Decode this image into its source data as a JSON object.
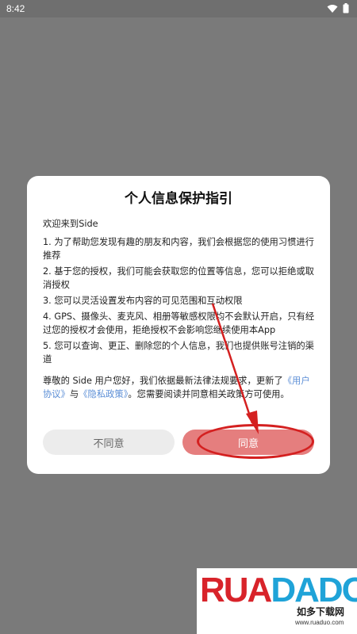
{
  "status_bar": {
    "time": "8:42",
    "icons": [
      "wifi-icon",
      "battery-icon"
    ]
  },
  "dialog": {
    "title": "个人信息保护指引",
    "welcome": "欢迎来到Side",
    "items": [
      "1. 为了帮助您发现有趣的朋友和内容，我们会根据您的使用习惯进行推荐",
      "2. 基于您的授权，我们可能会获取您的位置等信息，您可以拒绝或取消授权",
      "3. 您可以灵活设置发布内容的可见范围和互动权限",
      "4. GPS、摄像头、麦克风、相册等敏感权限均不会默认开启，只有经过您的授权才会使用，拒绝授权不会影响您继续使用本App",
      "5. 您可以查询、更正、删除您的个人信息，我们也提供账号注销的渠道"
    ],
    "notice_prefix": "尊敬的 Side 用户您好，我们依据最新法律法规要求，更新了",
    "user_agreement_link": "《用户协议》",
    "notice_and": "与",
    "privacy_policy_link": "《隐私政策》",
    "notice_suffix": "。您需要阅读并同意相关政策方可使用。",
    "disagree_label": "不同意",
    "agree_label": "同意"
  },
  "watermark": {
    "logo_part1": "RUA",
    "logo_part2": "DADO",
    "cn_text": "如多下载网",
    "url": "www.ruaduo.com"
  },
  "colors": {
    "overlay": "#7a7a7a",
    "agree_button": "#e57e7e",
    "disagree_button": "#ececec",
    "link": "#5b8ed6",
    "annotation": "#d42020"
  }
}
